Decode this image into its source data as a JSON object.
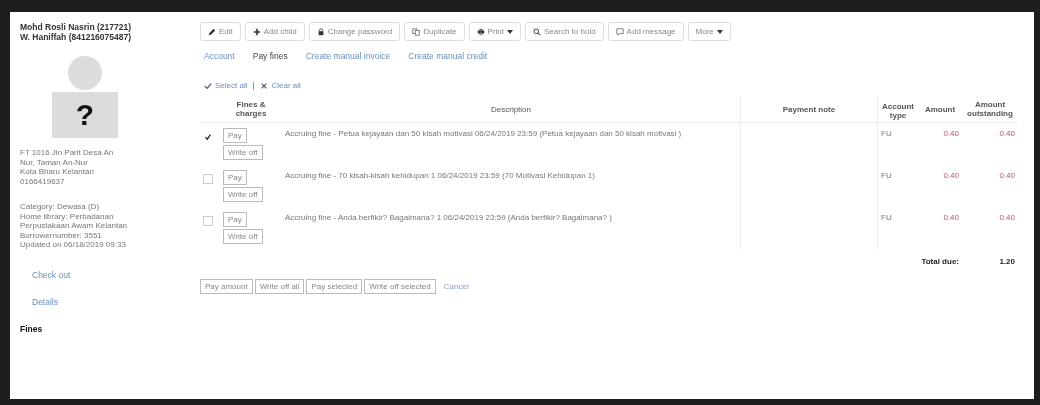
{
  "patron": {
    "name": "Mohd Rosli Nasrin (217721)",
    "cardnumber": "W. Haniffah (841216075487)",
    "avatar_mark": "?",
    "address": [
      "FT 1016 Jln Parit Desa An",
      "Nur, Taman An-Nur",
      "Kota Bharu Kelantan",
      "0166419637"
    ],
    "info": [
      "Category: Dewasa (D)",
      "Home library: Perbadanan",
      "Perpustakaan Awam Kelantan",
      "Borrowernumber: 3551",
      "Updated on 06/18/2019 09:33"
    ]
  },
  "sidenav": [
    {
      "label": "Check out",
      "selected": false
    },
    {
      "label": "Details",
      "selected": false
    },
    {
      "label": "Fines",
      "selected": true
    }
  ],
  "toolbar": [
    {
      "label": "Edit",
      "kind": "pencil",
      "caret": false
    },
    {
      "label": "Add child",
      "kind": "plus",
      "caret": false
    },
    {
      "label": "Change password",
      "kind": "lock",
      "caret": false
    },
    {
      "label": "Duplicate",
      "kind": "copy",
      "caret": false
    },
    {
      "label": "Print",
      "kind": "print",
      "caret": true
    },
    {
      "label": "Search to hold",
      "kind": "search",
      "caret": false
    },
    {
      "label": "Add message",
      "kind": "message",
      "caret": false
    },
    {
      "label": "More",
      "kind": "plain",
      "caret": true
    }
  ],
  "tabs": [
    {
      "label": "Account",
      "selected": false
    },
    {
      "label": "Pay fines",
      "selected": true
    },
    {
      "label": "Create manual invoice",
      "selected": false
    },
    {
      "label": "Create manual credit",
      "selected": false
    }
  ],
  "select_all": "Select all",
  "clear_all": "Clear all",
  "table": {
    "columns": [
      "Fines & charges",
      "Description",
      "Payment note",
      "Account type",
      "Amount",
      "Amount outstanding"
    ],
    "rows": [
      {
        "checked": true,
        "pay": "Pay",
        "write_off": "Write off",
        "description": "Accruing fine - Petua kejayaan dan 50 kisah motivasi 06/24/2019 23:59 (Petua kejayaan dan 50 kisah motivasi )",
        "account_type": "FU",
        "amount": "0.40",
        "outstanding": "0.40"
      },
      {
        "checked": false,
        "pay": "Pay",
        "write_off": "Write off",
        "description": "Accruing fine - 70 kisah-kisah kehidupan 1 06/24/2019 23:59 (70 Motivasi Kehidupan 1)",
        "account_type": "FU",
        "amount": "0.40",
        "outstanding": "0.40"
      },
      {
        "checked": false,
        "pay": "Pay",
        "write_off": "Write off",
        "description": "Accruing fine - Anda berfikir? Bagaimana? 1 06/24/2019 23:59 (Anda berfikir? Bagaimana? )",
        "account_type": "FU",
        "amount": "0.40",
        "outstanding": "0.40"
      }
    ],
    "total_label": "Total due:",
    "total": "1.20"
  },
  "actions": [
    "Pay amount",
    "Write off all",
    "Pay selected",
    "Write off selected"
  ],
  "cancel": "Cancel"
}
